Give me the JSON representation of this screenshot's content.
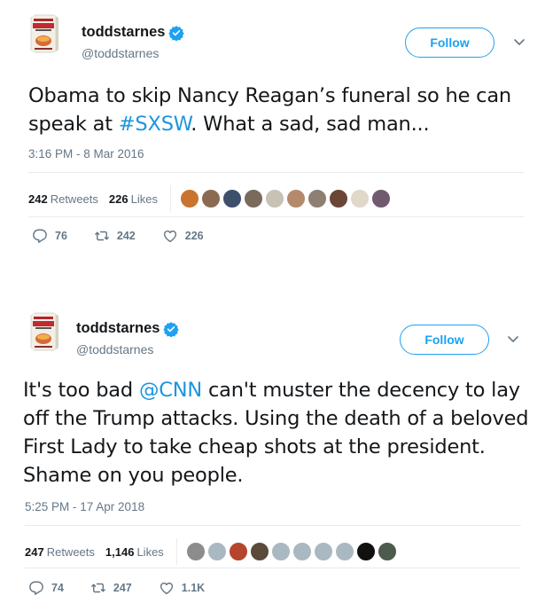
{
  "tweets": [
    {
      "display_name": "toddstarnes",
      "handle": "@toddstarnes",
      "follow_label": "Follow",
      "text_parts": [
        "Obama to skip Nancy Reagan’s funeral so he can speak at ",
        "#SXSW",
        ". What a sad, sad man..."
      ],
      "timestamp": "3:16 PM - 8 Mar 2016",
      "retweets_count": "242",
      "retweets_label": "Retweets",
      "likes_count": "226",
      "likes_label": "Likes",
      "actions": {
        "reply": "76",
        "retweet": "242",
        "like": "226"
      },
      "liker_colors": [
        "#c9742e",
        "#8a6b52",
        "#3d4f6b",
        "#7a6a5c",
        "#c8c2b4",
        "#b38a6a",
        "#8d8073",
        "#6b4536",
        "#e0d8c8",
        "#6f5a6e"
      ]
    },
    {
      "display_name": "toddstarnes",
      "handle": "@toddstarnes",
      "follow_label": "Follow",
      "text_parts": [
        "It's too bad ",
        "@CNN",
        " can't muster the decency to lay off the Trump attacks. Using the death of a beloved First Lady to take cheap shots at the president. Shame on you people."
      ],
      "timestamp": "5:25 PM - 17 Apr 2018",
      "retweets_count": "247",
      "retweets_label": "Retweets",
      "likes_count": "1,146",
      "likes_label": "Likes",
      "actions": {
        "reply": "74",
        "retweet": "247",
        "like": "1.1K"
      },
      "liker_colors": [
        "#8c8c8c",
        "#aab8c2",
        "#b5452c",
        "#5a4a3a",
        "#aab8c2",
        "#aab8c2",
        "#aab8c2",
        "#aab8c2",
        "#111111",
        "#4d5a4d"
      ]
    }
  ],
  "colors": {
    "accent": "#1da1f2",
    "link": "#1b95e0",
    "muted": "#657786",
    "verified": "#1da1f2"
  },
  "icons": [
    "verified-icon",
    "chevron-down-icon",
    "reply-icon",
    "retweet-icon",
    "like-icon",
    "book-cover-avatar"
  ]
}
